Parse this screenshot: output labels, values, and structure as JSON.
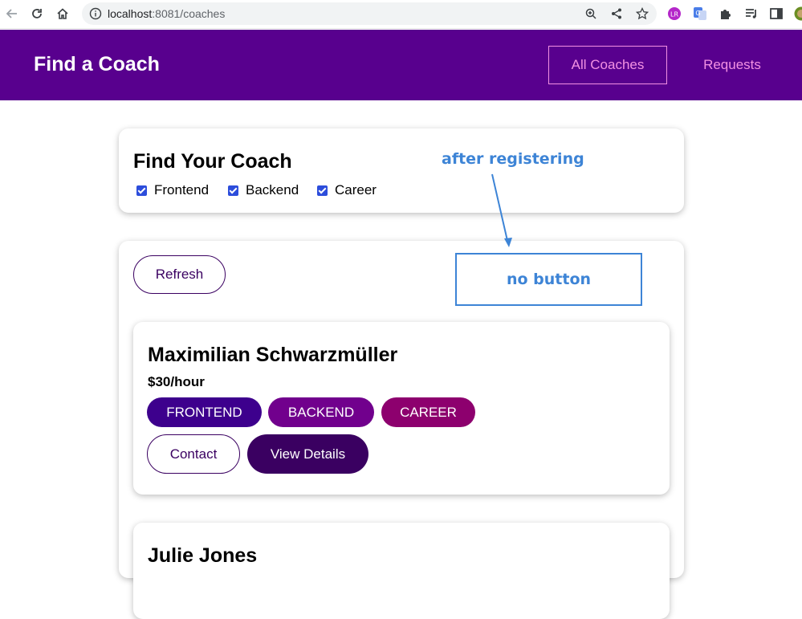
{
  "browser": {
    "url_host": "localhost",
    "url_rest": ":8081/coaches",
    "icons": [
      "back-icon",
      "reload-icon",
      "home-icon",
      "info-icon",
      "zoom-icon",
      "share-icon",
      "star-icon",
      "extension-icon"
    ]
  },
  "header": {
    "brand": "Find a Coach",
    "nav_all": "All Coaches",
    "nav_requests": "Requests"
  },
  "filter": {
    "title": "Find Your Coach",
    "options": [
      {
        "label": "Frontend",
        "checked": true
      },
      {
        "label": "Backend",
        "checked": true
      },
      {
        "label": "Career",
        "checked": true
      }
    ]
  },
  "list": {
    "refresh_label": "Refresh",
    "coaches": [
      {
        "name": "Maximilian Schwarzmüller",
        "rate": "$30/hour",
        "areas": [
          "FRONTEND",
          "BACKEND",
          "CAREER"
        ],
        "contact_label": "Contact",
        "details_label": "View Details"
      },
      {
        "name": "Julie Jones"
      }
    ]
  },
  "annotation": {
    "note": "after registering",
    "box_text": "no button"
  },
  "colors": {
    "header_bg": "#58008e",
    "nav_accent": "#f391e3",
    "frontend": "#3d008d",
    "backend": "#71008d",
    "career": "#8d006e",
    "annotation": "#3d84d6"
  }
}
